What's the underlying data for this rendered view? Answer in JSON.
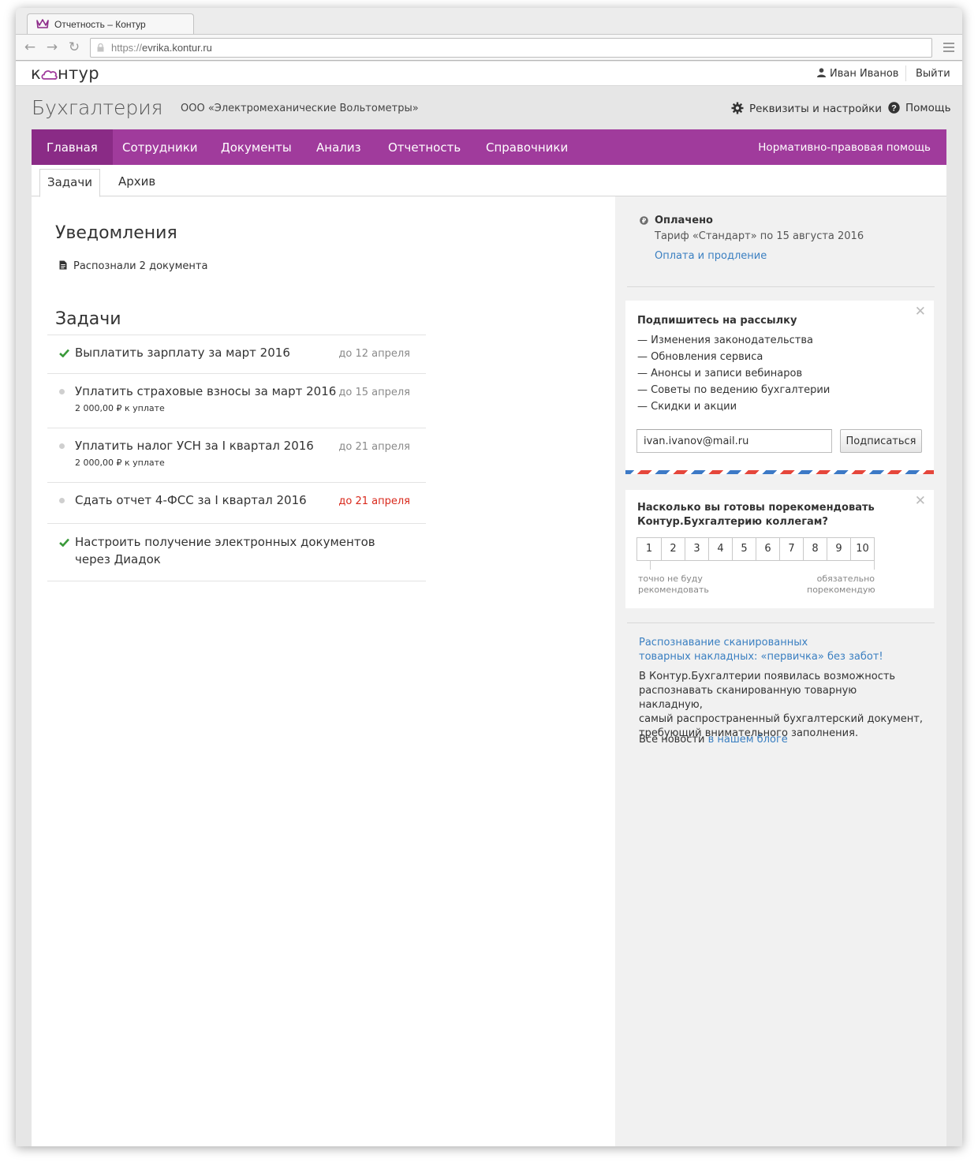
{
  "browser": {
    "tab_title": "Отчетность – Контур",
    "url_scheme": "https://",
    "url_host": "evrika.kontur.ru"
  },
  "header": {
    "logo_k": "к",
    "logo_rest": "нтур",
    "user_name": "Иван Иванов",
    "logout": "Выйти"
  },
  "product": {
    "title": "Бухгалтерия",
    "org": "ООО «Электромеханические Вольтометры»",
    "settings": "Реквизиты и настройки",
    "help": "Помощь"
  },
  "nav": {
    "items": [
      "Главная",
      "Сотрудники",
      "Документы",
      "Анализ",
      "Отчетность",
      "Справочники"
    ],
    "right": "Нормативно-правовая помощь",
    "accent": "#a03b9c"
  },
  "subtabs": [
    "Задачи",
    "Архив"
  ],
  "notifications": {
    "title": "Уведомления",
    "item": "Распознали 2 документа"
  },
  "tasks": {
    "title": "Задачи",
    "items": [
      {
        "title": "Выплатить зарплату за март 2016",
        "sub": "",
        "due": "до 12 апреля",
        "status": "done"
      },
      {
        "title": "Уплатить страховые взносы за март 2016",
        "sub": "2 000,00 ₽ к уплате",
        "due": "до 15 апреля",
        "status": "pending"
      },
      {
        "title": "Уплатить налог УСН за I квартал 2016",
        "sub": "2 000,00 ₽ к уплате",
        "due": "до 21 апреля",
        "status": "pending"
      },
      {
        "title": "Сдать отчет 4-ФСС за I квартал 2016",
        "sub": "",
        "due": "до 21 апреля",
        "status": "overdue"
      },
      {
        "title_line1": "Настроить получение электронных документов",
        "title_line2": "через Диадок",
        "status": "done"
      }
    ]
  },
  "sidebar": {
    "paid_title": "Оплачено",
    "paid_tariff": "Тариф «Стандарт» по 15 августа 2016",
    "paid_link": "Оплата и продление",
    "subscribe": {
      "title": "Подпишитесь на рассылку",
      "items": [
        "— Изменения законодательства",
        "— Обновления сервиса",
        "— Анонсы и записи вебинаров",
        "— Советы по ведению бухгалтерии",
        "— Скидки и акции"
      ],
      "email_value": "ivan.ivanov@mail.ru",
      "button": "Подписаться"
    },
    "rating": {
      "question": "Насколько вы готовы порекомендовать Контур.Бухгалтерию коллегам?",
      "scale": [
        "1",
        "2",
        "3",
        "4",
        "5",
        "6",
        "7",
        "8",
        "9",
        "10"
      ],
      "low_line1": "точно не буду",
      "low_line2": "рекомендовать",
      "high_line1": "обязательно",
      "high_line2": "порекомендую"
    },
    "news": {
      "link_line1": "Распознавание сканированных",
      "link_line2": "товарных накладных: «первичка» без забот!",
      "body_line1": "В Контур.Бухгалтерии появилась возможность",
      "body_line2": "распознавать сканированную товарную накладную,",
      "body_line3": "самый распространенный бухгалтерский документ,",
      "body_line4": "требующий внимательного заполнения.",
      "more_text": "Все новости",
      "more_link": "в нашем блоге"
    }
  }
}
